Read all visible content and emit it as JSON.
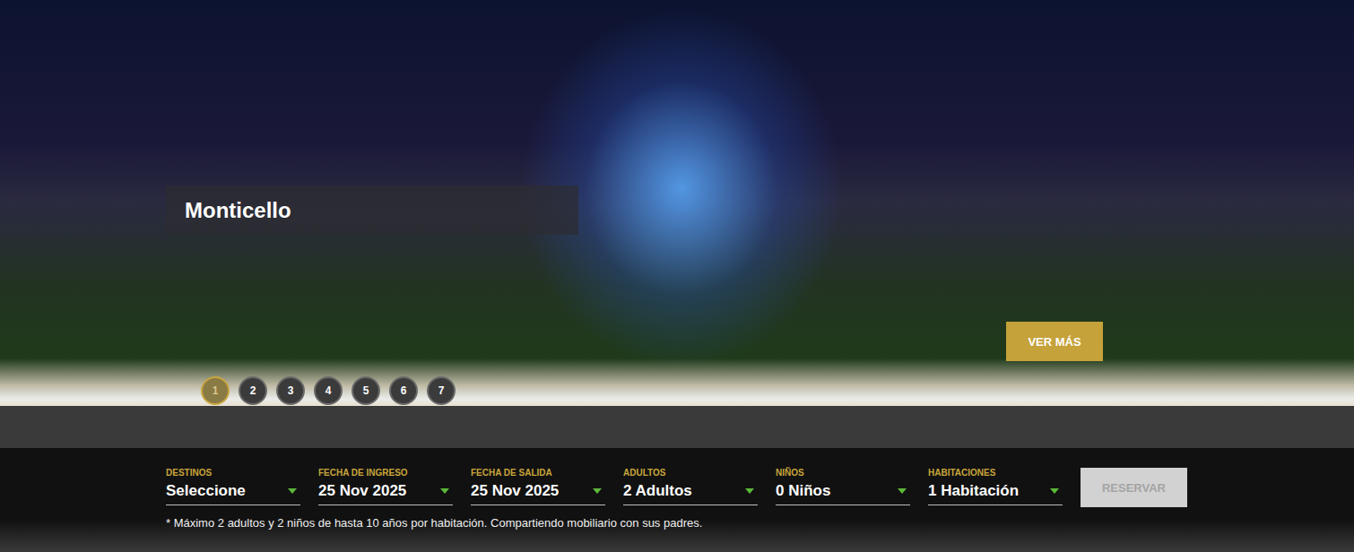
{
  "hero": {
    "caption": "Monticello",
    "button": "VER MÁS"
  },
  "slides": [
    {
      "label": "1",
      "selected": true
    },
    {
      "label": "2",
      "selected": false
    },
    {
      "label": "3",
      "selected": false
    },
    {
      "label": "4",
      "selected": false
    },
    {
      "label": "5",
      "selected": false
    },
    {
      "label": "6",
      "selected": false
    },
    {
      "label": "7",
      "selected": false
    }
  ],
  "booking": {
    "fields": [
      {
        "label": "DESTINOS",
        "value": "Seleccione"
      },
      {
        "label": "FECHA DE INGRESO",
        "value": "25 Nov 2025"
      },
      {
        "label": "FECHA DE SALIDA",
        "value": "25 Nov 2025"
      },
      {
        "label": "ADULTOS",
        "value": "2 Adultos"
      },
      {
        "label": "NIÑOS",
        "value": "0 Niños"
      },
      {
        "label": "HABITACIONES",
        "value": "1 Habitación"
      }
    ],
    "button": {
      "label": "RESERVAR",
      "disabled": true
    },
    "note": "* Máximo 2 adultos y 2 niños de hasta 10 años por habitación. Compartiendo mobiliario con sus padres."
  }
}
